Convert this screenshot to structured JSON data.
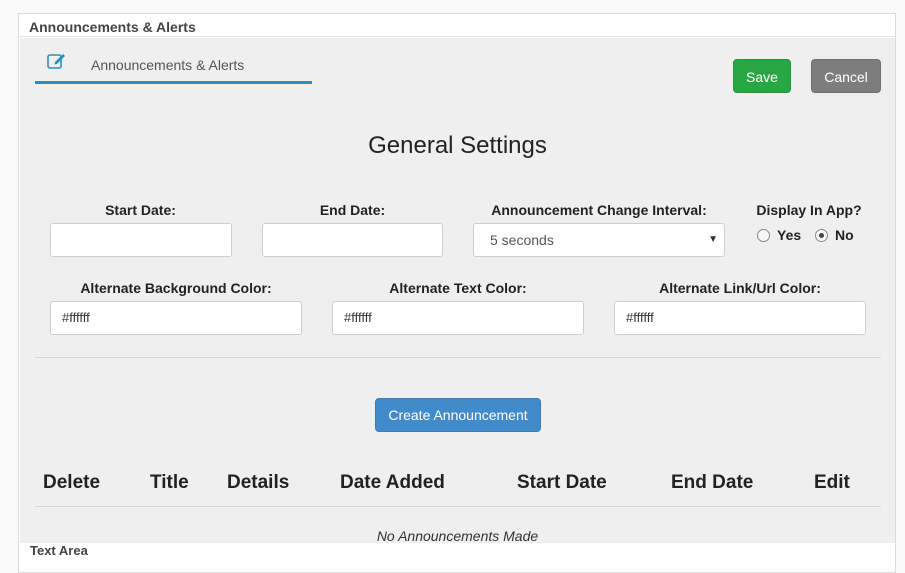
{
  "panel": {
    "title": "Announcements & Alerts"
  },
  "tab": {
    "label": "Announcements & Alerts",
    "icon": "edit-icon"
  },
  "actions": {
    "save_label": "Save",
    "cancel_label": "Cancel"
  },
  "section_title": "General Settings",
  "fields": {
    "start_date": {
      "label": "Start Date:",
      "value": ""
    },
    "end_date": {
      "label": "End Date:",
      "value": ""
    },
    "interval": {
      "label": "Announcement Change Interval:",
      "value": "5 seconds"
    },
    "display": {
      "label": "Display In App?",
      "yes_label": "Yes",
      "no_label": "No",
      "selected": "No"
    },
    "alt_bg": {
      "label": "Alternate Background Color:",
      "value": "#ffffff"
    },
    "alt_text": {
      "label": "Alternate Text Color:",
      "value": "#ffffff"
    },
    "alt_link": {
      "label": "Alternate Link/Url Color:",
      "value": "#ffffff"
    }
  },
  "create_label": "Create Announcement",
  "table": {
    "columns": [
      "Delete",
      "Title",
      "Details",
      "Date Added",
      "Start Date",
      "End Date",
      "Edit"
    ],
    "empty_text": "No Announcements Made"
  },
  "next_panel_title": "Text Area",
  "colors": {
    "save": "#28a745",
    "cancel": "#7d7d7d",
    "primary": "#428bca",
    "tab_underline": "#2a8fbd"
  }
}
